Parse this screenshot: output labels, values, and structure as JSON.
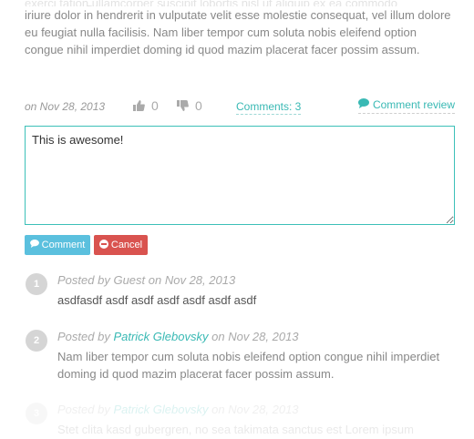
{
  "review": {
    "faded_line": "exerci tation ullamcorper suscipit lobortis nisl ut aliquip ex ea commodo consequat. Duis autem vel eum",
    "body": "iriure dolor in hendrerit in vulputate velit esse molestie consequat, vel illum dolore eu feugiat nulla facilisis. Nam liber tempor cum soluta nobis eleifend option congue nihil imperdiet doming id quod mazim placerat facer possim assum."
  },
  "meta": {
    "date": "on Nov 28, 2013",
    "likes": "0",
    "dislikes": "0",
    "comments_link": "Comments: 3",
    "comment_review": "Comment review"
  },
  "form": {
    "textarea_value": "This is awesome!",
    "comment_button": "Comment",
    "cancel_button": "Cancel"
  },
  "comments": [
    {
      "number": "1",
      "posted_by": "Posted by",
      "author": "Guest",
      "on": "on Nov 28, 2013",
      "text": "asdfasdf asdf asdf asdf asdf asdf asdf"
    },
    {
      "number": "2",
      "posted_by": "Posted by",
      "author": "Patrick Glebovsky",
      "on": "on Nov 28, 2013",
      "text": "Nam liber tempor cum soluta nobis eleifend option congue nihil imperdiet doming id quod mazim placerat facer possim assum."
    },
    {
      "number": "3",
      "posted_by": "Posted by",
      "author": "Patrick Glebovsky",
      "on": "on Nov 28, 2013",
      "text": "Stet clita kasd gubergren, no sea takimata sanctus est Lorem ipsum"
    }
  ],
  "colors": {
    "accent": "#39b9b4",
    "comment_button": "#5bc0de",
    "cancel_button": "#d9534f",
    "number_badge": "#d5d5d5"
  }
}
